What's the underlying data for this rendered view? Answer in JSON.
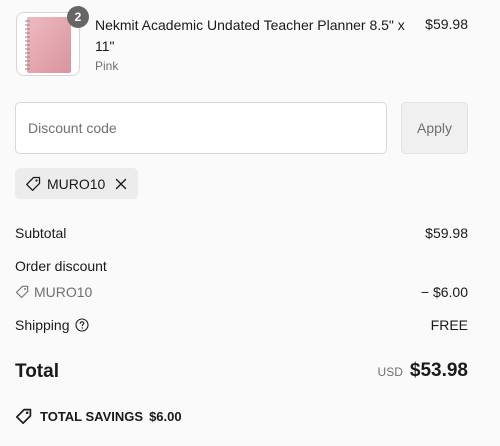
{
  "product": {
    "quantity": "2",
    "title": "Nekmit Academic Undated Teacher Planner 8.5\" x 11\"",
    "variant": "Pink",
    "price": "$59.98",
    "thumbnail_color": "#e6a0a8"
  },
  "discount": {
    "placeholder": "Discount code",
    "apply_label": "Apply",
    "applied_code": "MURO10"
  },
  "summary": {
    "subtotal_label": "Subtotal",
    "subtotal_value": "$59.98",
    "order_discount_label": "Order discount",
    "order_discount_code": "MURO10",
    "order_discount_value": "− $6.00",
    "shipping_label": "Shipping",
    "shipping_value": "FREE",
    "total_label": "Total",
    "currency": "USD",
    "total_value": "$53.98",
    "savings_label": "TOTAL SAVINGS",
    "savings_value": "$6.00"
  },
  "icons": {
    "tag": "tag-icon",
    "close": "close-icon",
    "help": "help-circle-icon",
    "savings": "tag-icon"
  }
}
